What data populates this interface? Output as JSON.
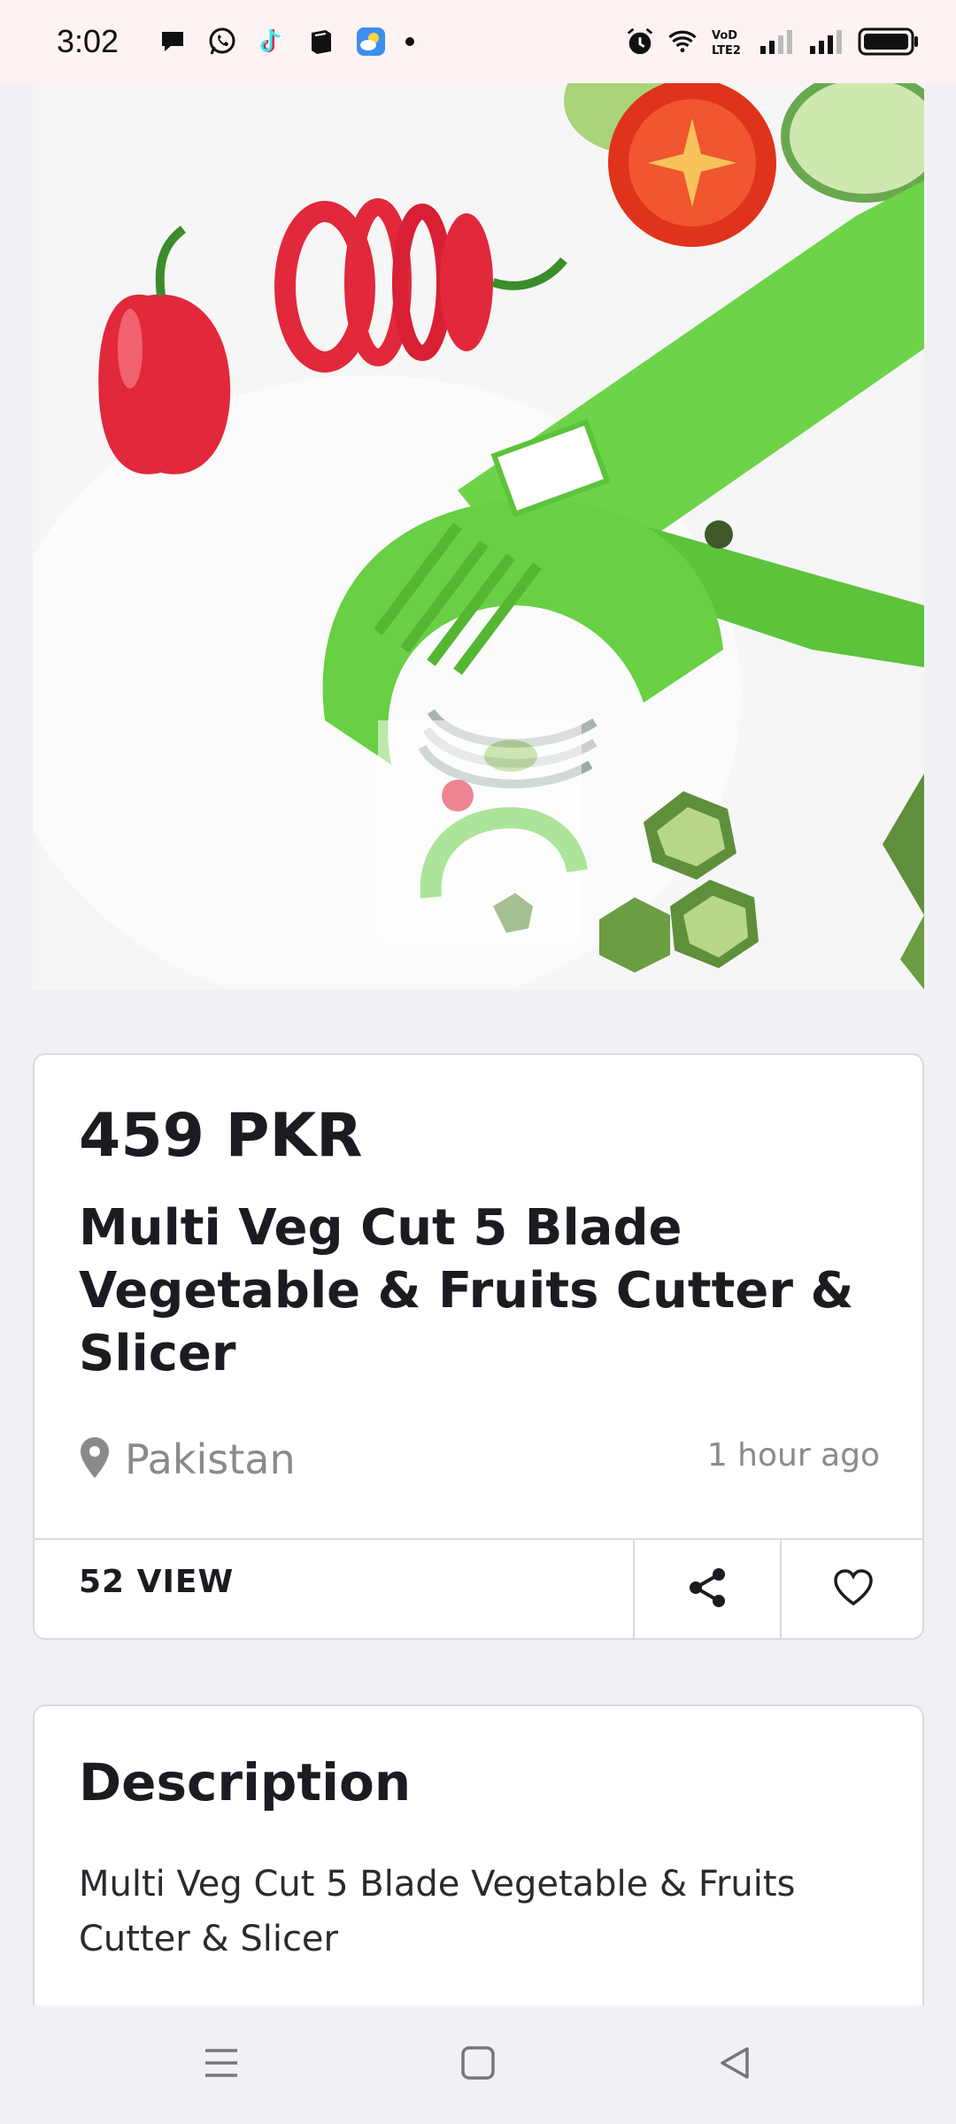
{
  "status_bar": {
    "time": "3:02",
    "left_icons": [
      "chat-bubble-icon",
      "whatsapp-icon",
      "tiktok-icon",
      "book-icon",
      "weather-icon",
      "dot-icon"
    ],
    "right_icons": [
      "alarm-icon",
      "wifi-icon",
      "volte-icon",
      "signal-icon",
      "signal-icon",
      "battery-icon"
    ],
    "network_label": "VoD LTE2"
  },
  "product": {
    "image_alt": "vegetable-cutter-photo",
    "price": "459 PKR",
    "title": "Multi Veg Cut 5 Blade Vegetable & Fruits Cutter & Slicer",
    "location": "Pakistan",
    "posted": "1 hour ago",
    "views": "52 VIEW"
  },
  "description": {
    "heading": "Description",
    "body": "Multi Veg Cut 5 Blade Vegetable & Fruits Cutter & Slicer"
  },
  "colors": {
    "accent_green": "#6dd44a",
    "text_dark": "#1b1b22",
    "text_muted": "#8a8a8e",
    "border": "#d9d9de"
  },
  "navigation": {
    "icons": [
      "menu-icon",
      "home-icon",
      "back-icon"
    ]
  }
}
